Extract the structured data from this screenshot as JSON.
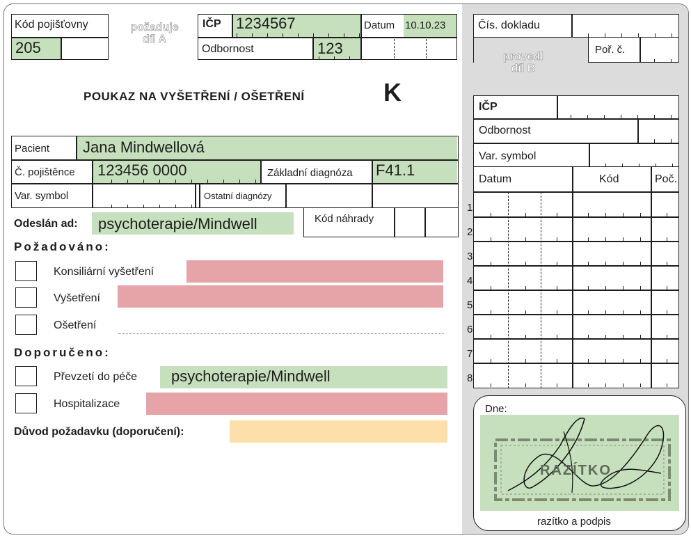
{
  "part_a": {
    "insurer_code_label": "Kód pojišťovny",
    "insurer_code_value": "205",
    "requests_part_a": "požaduje\ndíl A",
    "icp_label": "IČP",
    "icp_value": "1234567",
    "date_label": "Datum",
    "date_value": "10.10.23",
    "specialty_label": "Odbornost",
    "specialty_value": "123",
    "title": "POUKAZ NA VYŠETŘENÍ / OŠETŘENÍ",
    "form_letter": "K",
    "patient_label": "Pacient",
    "patient_value": "Jana Mindwellová",
    "insured_no_label": "Č. pojištěnce",
    "insured_no_value": "123456 0000",
    "main_diagnosis_label": "Základní diagnóza",
    "main_diagnosis_value": "F41.1",
    "var_symbol_label": "Var. symbol",
    "other_diagnoses_label": "Ostatní diagnózy",
    "sent_from_label": "Odeslán ad:",
    "sent_from_value": "psychoterapie/Mindwell",
    "reimbursement_code_label": "Kód náhrady",
    "requested_heading": "Požadováno:",
    "requested_items": [
      "Konsiliární vyšetření",
      "Vyšetření",
      "Ošetření"
    ],
    "recommended_heading": "Doporučeno:",
    "recommended_items": [
      "Převzetí do péče",
      "Hospitalizace"
    ],
    "care_takeover_value": "psychoterapie/Mindwell",
    "reason_label": "Důvod požadavku (doporučení):"
  },
  "part_b": {
    "document_no_label": "Čís. dokladu",
    "performed_part_b": "provedl\ndíl B",
    "order_no_label": "Poř. č.",
    "icp_label": "IČP",
    "specialty_label": "Odbornost",
    "var_symbol_label": "Var. symbol",
    "table_headers": [
      "Datum",
      "Kód",
      "Poč."
    ],
    "row_numbers": [
      "1",
      "2",
      "3",
      "4",
      "5",
      "6",
      "7",
      "8"
    ],
    "day_label": "Dne:",
    "stamp_text": "RAZÍTKO",
    "stamp_caption": "razítko a podpis"
  },
  "colors": {
    "filled_field": "#c6e0bd",
    "required_field": "#e6a3a8",
    "note_field": "#fddfaa",
    "part_b_background": "#dcdcdc"
  }
}
